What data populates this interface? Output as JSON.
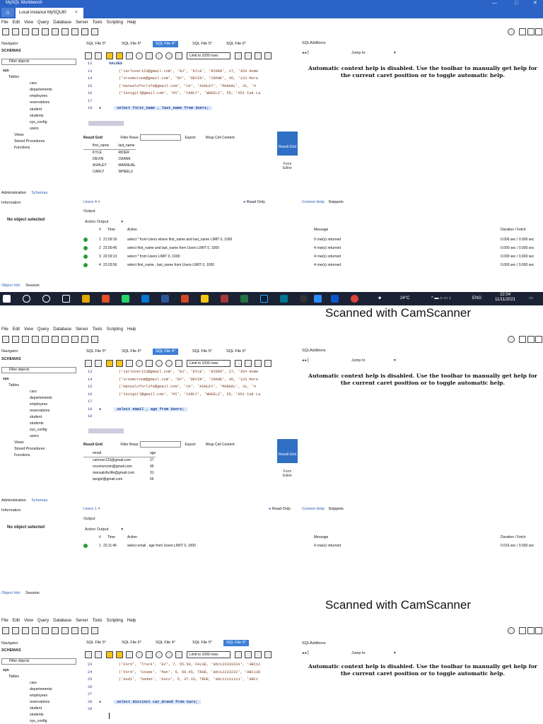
{
  "app": {
    "title": "MySQL Workbench",
    "connection_tab": "Local instance MySQL80",
    "close_glyph": "×",
    "window_controls": [
      "—",
      "□",
      "✕"
    ]
  },
  "menu": [
    "File",
    "Edit",
    "View",
    "Query",
    "Database",
    "Server",
    "Tools",
    "Scripting",
    "Help"
  ],
  "navigator": {
    "title": "Navigator",
    "schemas_label": "SCHEMAS",
    "filter_placeholder": "Filter objects",
    "tree": [
      "sys",
      "Tables",
      "cars",
      "departements",
      "employees",
      "reservations",
      "student",
      "students",
      "sys_config",
      "users",
      "Views",
      "Stored Procedures",
      "Functions"
    ],
    "bottom_tabs": [
      "Administration",
      "Schemas"
    ]
  },
  "info_panel": {
    "title": "Information",
    "no_object": "No object selected",
    "bottom_tabs": [
      "Object Info",
      "Session"
    ]
  },
  "sql_tabs": [
    "SQL File 5*",
    "SQL File 6*",
    "SQL File 4*",
    "SQL File 5*",
    "SQL File 6*"
  ],
  "editor_toolbar": {
    "limit_label": "Limit to 1000 rows"
  },
  "sql_additions": {
    "title": "SQLAdditions",
    "jump_to": "Jump to",
    "context_help": "Automatic context help is disabled. Use the toolbar to manually get help for the current caret position or to toggle automatic help.",
    "tabs": [
      "Context Help",
      "Snippets"
    ]
  },
  "result_grid": {
    "toolbar": {
      "result_grid": "Result Grid",
      "filter_rows": "Filter Rows:",
      "export": "Export:",
      "wrap": "Wrap Cell Content:"
    },
    "side_buttons": {
      "result_grid": "Result Grid",
      "form_editor": "Form Editor"
    }
  },
  "output": {
    "title": "Output",
    "action_output": "Action Output",
    "headers": {
      "num": "#",
      "time": "Time",
      "action": "Action",
      "message": "Message",
      "duration": "Duration / Fetch"
    }
  },
  "screens": [
    {
      "active_tab_index": 2,
      "code": [
        {
          "ln": "12",
          "text": "",
          "kw": "VALUES"
        },
        {
          "ln": "13",
          "text": "('carlover123@gmail.com', 'NJ', 'KYLE', 'RIDER', 27, '354 Home"
        },
        {
          "ln": "14",
          "text": "('vroomvroom@gmail.com', 'NY', 'DEVIN', 'CRANK', 45, '123 More"
        },
        {
          "ln": "15",
          "text": "('manualzforlife@gmail.com', 'CA', 'ASHLEY', 'MANUAL', 31, '4"
        },
        {
          "ln": "16",
          "text": "('taxigirl@gmail.com', 'MI', 'CARLY', 'WHEELZ', 55, '651 Cab La"
        },
        {
          "ln": "17",
          "text": ""
        },
        {
          "ln": "18",
          "text": "select  first_name , last_name from Users;",
          "current": true
        }
      ],
      "result_headers": [
        "first_name",
        "last_name"
      ],
      "result_rows": [
        [
          "KYLE",
          "RIDER"
        ],
        [
          "DEVIN",
          "CRANK"
        ],
        [
          "ASHLEY",
          "MANNUAL"
        ],
        [
          "CARLY",
          "WHEELZ"
        ]
      ],
      "lower_tab": "Users 4",
      "read_only": "Read Only",
      "output_rows": [
        {
          "n": "1",
          "time": "21:59:16",
          "action": "select * from Users    where first_name and last_name LIMIT 0, 1000",
          "message": "0 row(s) returned",
          "duration": "0.000 sec / 0.000 sec"
        },
        {
          "n": "2",
          "time": "22:00:45",
          "action": "select first_name and last_name     from Users LIMIT 0, 1000",
          "message": "4 row(s) returned",
          "duration": "0.000 sec / 0.000 sec"
        },
        {
          "n": "3",
          "time": "22:03:13",
          "action": "select * from Users LIMIT 0, 1000",
          "message": "4 row(s) returned",
          "duration": "0.000 sec / 0.000 sec"
        },
        {
          "n": "4",
          "time": "22:03:56",
          "action": "select  first_name , last_name from Users LIMIT 0, 1000",
          "message": "4 row(s) returned",
          "duration": "0.000 sec / 0.000 sec"
        }
      ]
    },
    {
      "active_tab_index": 2,
      "code": [
        {
          "ln": "13",
          "text": "('carlover123@gmail.com', 'NJ', 'KYLE', 'RIDER', 27, '354 Home"
        },
        {
          "ln": "14",
          "text": "('vroomvroom@gmail.com', 'NY', 'DEVIN', 'CRANK', 45, '123 More"
        },
        {
          "ln": "15",
          "text": "('manualzforlife@gmail.com', 'CA', 'ASHLEY', 'MANUAL', 31, '4"
        },
        {
          "ln": "16",
          "text": "('taxigirl@gmail.com', 'MI', 'CARLY', 'WHEELZ', 55, '651 Cab La"
        },
        {
          "ln": "17",
          "text": ""
        },
        {
          "ln": "18",
          "text": "select  email , age from Users;",
          "current": true
        },
        {
          "ln": "19",
          "text": ""
        }
      ],
      "result_headers": [
        "email",
        "age"
      ],
      "result_rows": [
        [
          "carlover123@gmail.com",
          "27"
        ],
        [
          "vroomvroom@gmail.com",
          "45"
        ],
        [
          "manualzforlife@gmail.com",
          "31"
        ],
        [
          "taxigirl@gmail.com",
          "55"
        ]
      ],
      "lower_tab": "Users 1",
      "read_only": "Read Only",
      "output_rows": [
        {
          "n": "1",
          "time": "22:11:46",
          "action": "select  email , age from Users LIMIT 0, 1000",
          "message": "4 row(s) returned",
          "duration": "0.016 sec / 0.000 sec"
        }
      ]
    },
    {
      "active_tab_index": 4,
      "code": [
        {
          "ln": "23",
          "text": "('Ford', 'Truck', 'EV', 7, 55.50, FALSE, 'abc123333333', 'ABC12"
        },
        {
          "ln": "24",
          "text": "('Ford', 'Coupe', 'Man', 5, 60.45, TRUE, 'abc12222222', 'ABC130"
        },
        {
          "ln": "25",
          "text": "('Audi', 'Sedan', 'Auto', 5, 37.15, TRUE, 'abc11111111', 'ABC1"
        },
        {
          "ln": "26",
          "text": ""
        },
        {
          "ln": "27",
          "text": ""
        },
        {
          "ln": "28",
          "text": "select distinct car_brand  from Cars;",
          "current": true
        },
        {
          "ln": "29",
          "text": ""
        }
      ]
    }
  ],
  "taskbar": {
    "weather": "24°C",
    "lang": "ENG",
    "time": "22:04",
    "date": "11/11/2021"
  },
  "watermark": "Scanned with CamScanner",
  "colors": {
    "titlebar": "#2b63c6",
    "active_tab": "#3d7fd6",
    "ok_status": "#2c9b3a",
    "taskbar": "#1b2234"
  }
}
